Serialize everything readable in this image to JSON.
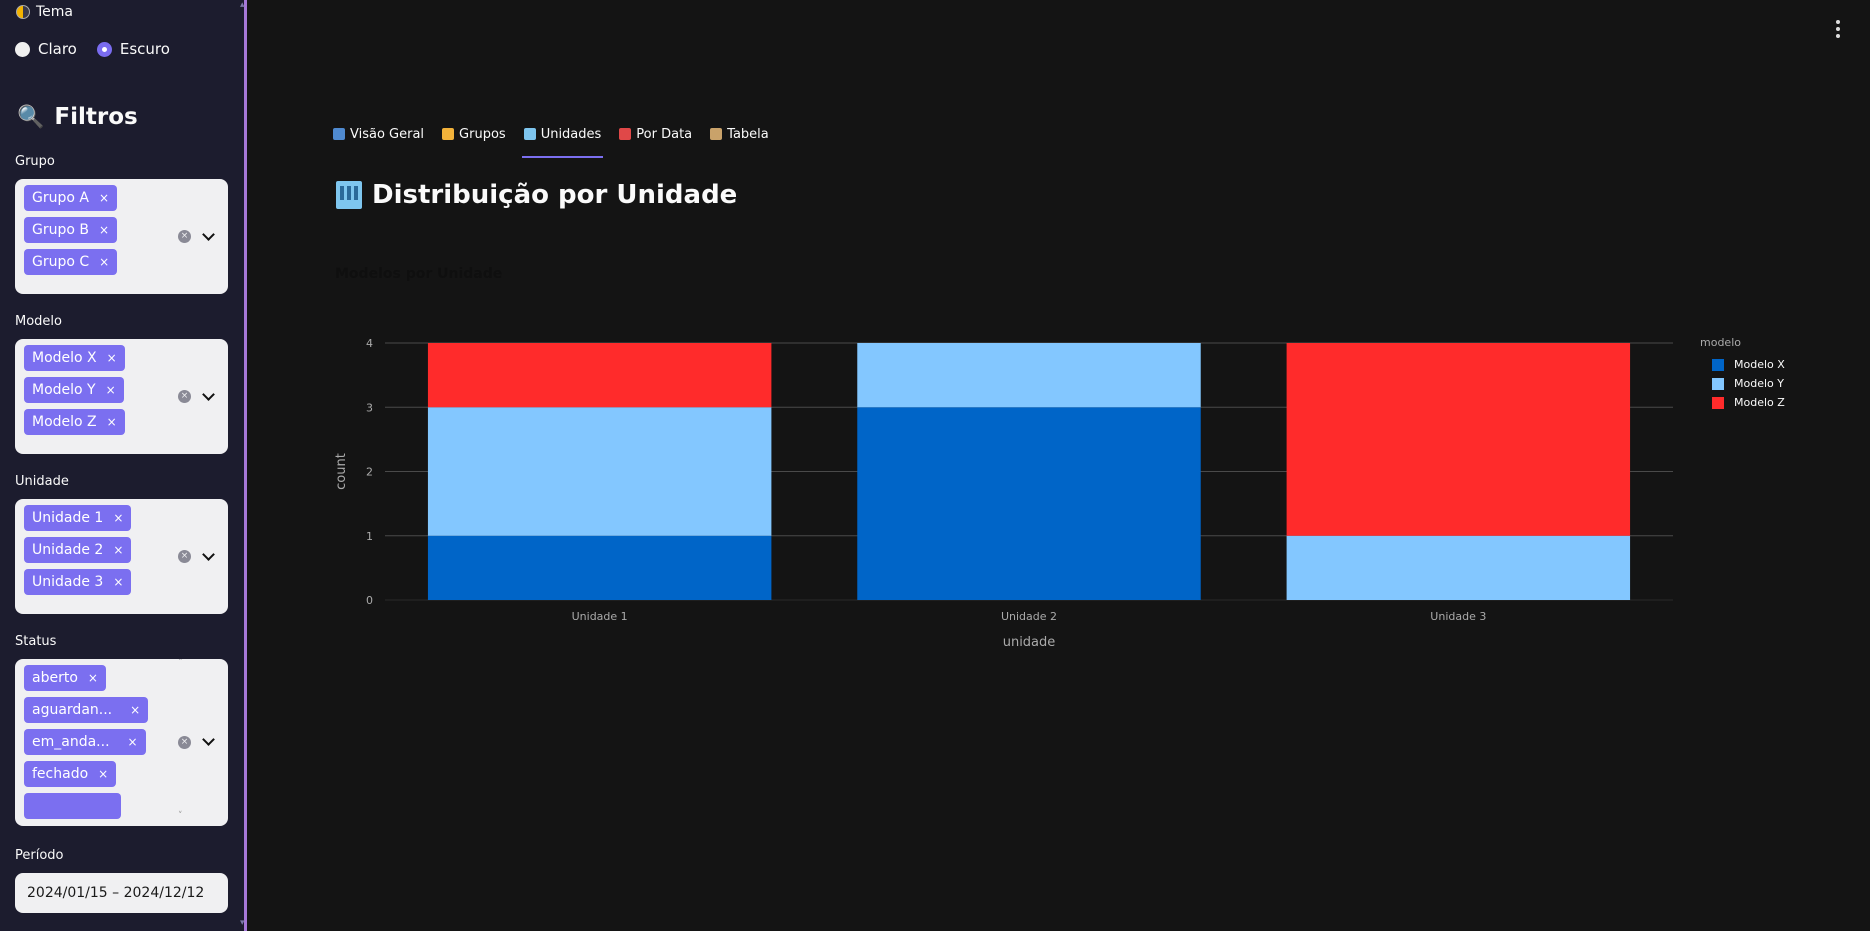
{
  "sidebar": {
    "theme": {
      "label": "Tema",
      "options": [
        {
          "label": "Claro",
          "selected": false
        },
        {
          "label": "Escuro",
          "selected": true
        }
      ]
    },
    "filters_title": "Filtros",
    "grupo": {
      "label": "Grupo",
      "chips": [
        "Grupo A",
        "Grupo B",
        "Grupo C"
      ]
    },
    "modelo": {
      "label": "Modelo",
      "chips": [
        "Modelo X",
        "Modelo Y",
        "Modelo Z"
      ]
    },
    "unidade": {
      "label": "Unidade",
      "chips": [
        "Unidade 1",
        "Unidade 2",
        "Unidade 3"
      ]
    },
    "status": {
      "label": "Status",
      "chips": [
        "aberto",
        "aguardan...",
        "em_anda...",
        "fechado",
        ""
      ]
    },
    "periodo": {
      "label": "Período",
      "value": "2024/01/15 – 2024/12/12"
    },
    "chip_remove": "×"
  },
  "tabs": [
    {
      "label": "Visão Geral",
      "icon": "bar-chart-icon",
      "active": false,
      "color": "#4f8ad0"
    },
    {
      "label": "Grupos",
      "icon": "folder-icon",
      "active": false,
      "color": "#f2b23a"
    },
    {
      "label": "Unidades",
      "icon": "building-icon",
      "active": true,
      "color": "#7ec6ef"
    },
    {
      "label": "Por Data",
      "icon": "calendar-icon",
      "active": false,
      "color": "#e04848"
    },
    {
      "label": "Tabela",
      "icon": "clipboard-icon",
      "active": false,
      "color": "#c9a26a"
    }
  ],
  "page_title": "Distribuição por Unidade",
  "chart_data": {
    "type": "bar",
    "stacked": true,
    "title": "Modelos por Unidade",
    "xlabel": "unidade",
    "ylabel": "count",
    "categories": [
      "Unidade 1",
      "Unidade 2",
      "Unidade 3"
    ],
    "yticks": [
      0,
      1,
      2,
      3,
      4
    ],
    "ylim": [
      0,
      4
    ],
    "grid": true,
    "legend_title": "modelo",
    "legend_position": "right",
    "series": [
      {
        "name": "Modelo X",
        "values": [
          1,
          3,
          0
        ],
        "color": "#0065c8"
      },
      {
        "name": "Modelo Y",
        "values": [
          2,
          1,
          1
        ],
        "color": "#83c7ff"
      },
      {
        "name": "Modelo Z",
        "values": [
          1,
          0,
          3
        ],
        "color": "#ff2b2b"
      }
    ]
  }
}
